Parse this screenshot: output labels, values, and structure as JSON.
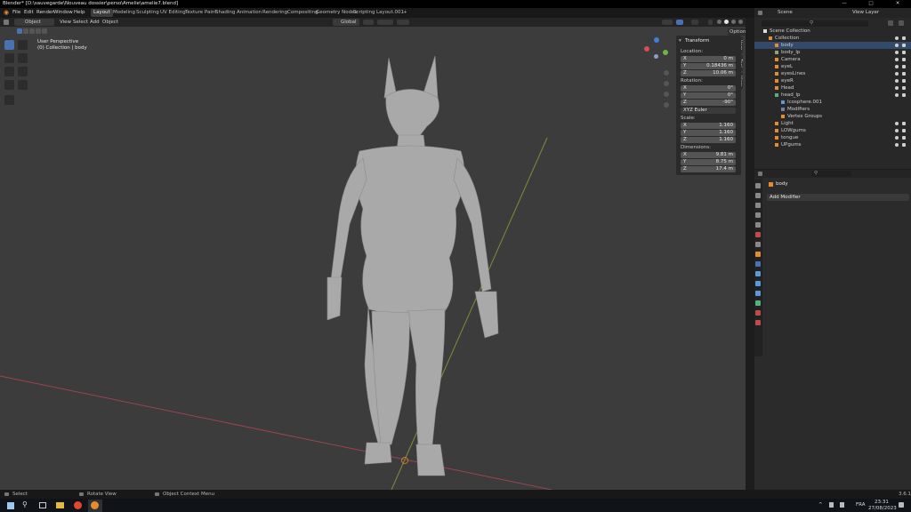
{
  "window": {
    "title": "Blender* [D:\\sauvegarde\\Nouveau dossier\\perso\\Amelie\\amelie7.blend]"
  },
  "menu": {
    "items": [
      "File",
      "Edit",
      "Render",
      "Window",
      "Help"
    ]
  },
  "workspaces": {
    "tabs": [
      "Layout",
      "Modeling",
      "Sculpting",
      "UV Editing",
      "Texture Paint",
      "Shading",
      "Animation",
      "Rendering",
      "Compositing",
      "Geometry Nodes",
      "Scripting",
      "Layout.001"
    ],
    "active": "Layout",
    "add_label": "+"
  },
  "viewport_header": {
    "mode": "Object Mode",
    "menus": [
      "View",
      "Select",
      "Add",
      "Object"
    ],
    "orientation": "Global",
    "options_label": "Options"
  },
  "viewport": {
    "perspective_label": "User Perspective",
    "collection_label": "(0) Collection | body"
  },
  "transform_panel": {
    "title": "Transform",
    "location_label": "Location:",
    "location": [
      {
        "axis": "X",
        "value": "0 m"
      },
      {
        "axis": "Y",
        "value": "0.18436 m"
      },
      {
        "axis": "Z",
        "value": "10.06 m"
      }
    ],
    "rotation_label": "Rotation:",
    "rotation": [
      {
        "axis": "X",
        "value": "0°"
      },
      {
        "axis": "Y",
        "value": "0°"
      },
      {
        "axis": "Z",
        "value": "-90°"
      }
    ],
    "rotation_mode": "XYZ Euler",
    "scale_label": "Scale:",
    "scale": [
      {
        "axis": "X",
        "value": "1.160"
      },
      {
        "axis": "Y",
        "value": "1.160"
      },
      {
        "axis": "Z",
        "value": "1.160"
      }
    ],
    "dimensions_label": "Dimensions:",
    "dimensions": [
      {
        "axis": "X",
        "value": "9.81 m"
      },
      {
        "axis": "Y",
        "value": "8.75 m"
      },
      {
        "axis": "Z",
        "value": "17.4 m"
      }
    ],
    "side_tabs": [
      "Item",
      "Tool",
      "View"
    ]
  },
  "outliner": {
    "scene_label": "Scene",
    "view_layer_label": "View Layer",
    "root": "Scene Collection",
    "rows": [
      {
        "name": "Collection",
        "indent": 0
      },
      {
        "name": "body",
        "indent": 1
      },
      {
        "name": "body_lp",
        "indent": 1
      },
      {
        "name": "Camera",
        "indent": 1
      },
      {
        "name": "eyeL",
        "indent": 1
      },
      {
        "name": "eyesLines",
        "indent": 1
      },
      {
        "name": "eyeR",
        "indent": 1
      },
      {
        "name": "Head",
        "indent": 1
      },
      {
        "name": "head_lp",
        "indent": 1
      },
      {
        "name": "Icosphere.001",
        "indent": 2
      },
      {
        "name": "Modifiers",
        "indent": 2
      },
      {
        "name": "Vertex Groups",
        "indent": 2
      },
      {
        "name": "Light",
        "indent": 1
      },
      {
        "name": "LOWgums",
        "indent": 1
      },
      {
        "name": "tongue",
        "indent": 1
      },
      {
        "name": "UPgums",
        "indent": 1
      }
    ]
  },
  "properties": {
    "object_name": "body",
    "add_modifier_label": "Add Modifier"
  },
  "statusbar": {
    "select": "Select",
    "rotate": "Rotate View",
    "context_menu": "Object Context Menu",
    "version": "3.6.1"
  },
  "taskbar": {
    "language": "FRA",
    "time": "23:31",
    "date": "27/08/2023"
  },
  "colors": {
    "accent": "#4772b3",
    "viewport_bg": "#3c3c3c",
    "x_axis": "#b54a55",
    "y_axis": "#8ca23a"
  }
}
